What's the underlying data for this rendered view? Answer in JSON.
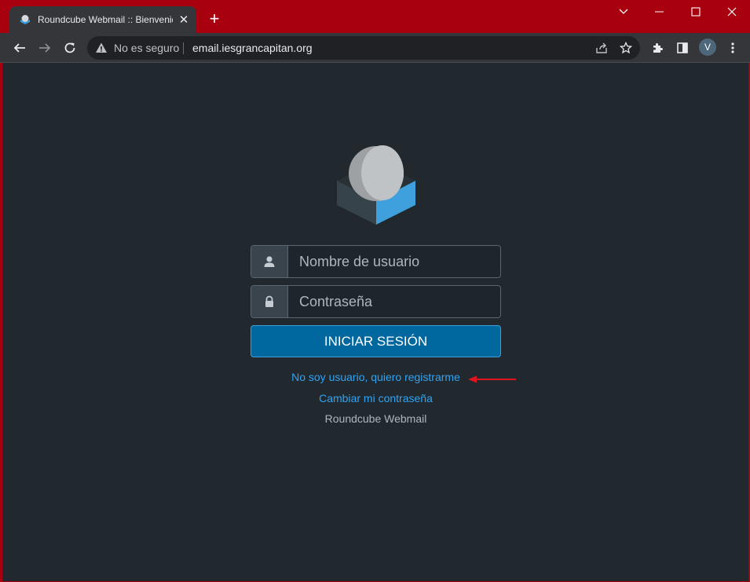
{
  "browser": {
    "tab_title": "Roundcube Webmail :: Bienvenido a Roundcube Webmail",
    "tab_close": "✕",
    "new_tab": "+",
    "security_text": "No es seguro",
    "url": "email.iesgrancapitan.org",
    "profile_initial": "V"
  },
  "login": {
    "username_placeholder": "Nombre de usuario",
    "password_placeholder": "Contraseña",
    "submit_label": "INICIAR SESIÓN",
    "register_link": "No soy usuario, quiero registrarme",
    "change_password_link": "Cambiar mi contraseña",
    "product_name": "Roundcube Webmail"
  },
  "colors": {
    "window_frame": "#a8000f",
    "page_background": "#22292e",
    "button_primary": "#00679f",
    "link": "#2fa3f4",
    "annotation_arrow": "#e0141e"
  }
}
